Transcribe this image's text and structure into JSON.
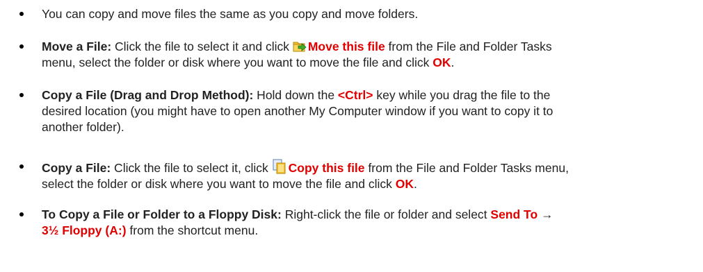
{
  "bullets": [
    {
      "text": "You can copy and move files the same as you copy and move folders."
    },
    {
      "lead": "Move a File:",
      "part1": " Click the file to select it and click ",
      "icon": "move-file-icon",
      "action": "Move this file",
      "part2": " from the File and Folder Tasks",
      "part3": "menu, select the folder or disk where you want to move the file and click ",
      "ok": "OK",
      "end": "."
    },
    {
      "lead": "Copy a File (Drag and Drop Method):",
      "part1": " Hold down the ",
      "key": "<Ctrl>",
      "part2": " key while you drag the file to the",
      "line2": "desired location (you might have to open another My Computer window if you want to copy it to",
      "line3": "another folder)."
    },
    {
      "lead": "Copy a File:",
      "part1": " Click the file to select it, click ",
      "icon": "copy-file-icon",
      "action": "Copy this file",
      "part2": " from the File and Folder Tasks menu,",
      "part3": "select the folder or disk where you want to move the file and click ",
      "ok": "OK",
      "end": "."
    },
    {
      "lead": "To Copy a File or Folder to a Floppy Disk:",
      "part1": " Right-click the file or folder and select ",
      "send": "Send To",
      "arrow": " → ",
      "floppy": "3½ Floppy (A:)",
      "part2": " from the shortcut menu."
    }
  ]
}
